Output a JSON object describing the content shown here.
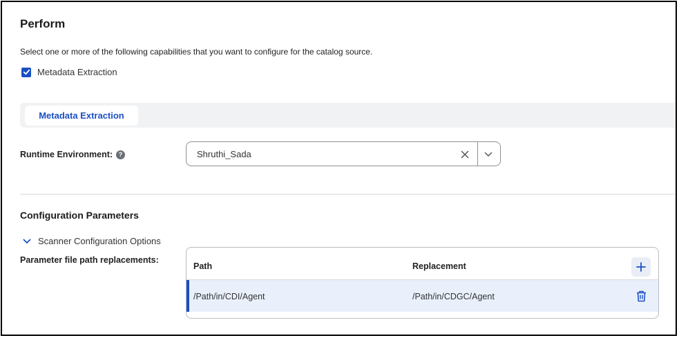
{
  "page": {
    "title": "Perform",
    "description": "Select one or more of the following capabilities that you want to configure for the catalog source."
  },
  "capabilities": [
    {
      "label": "Metadata Extraction",
      "checked": true
    }
  ],
  "tabs": [
    {
      "label": "Metadata Extraction",
      "active": true
    }
  ],
  "runtime": {
    "label": "Runtime Environment:",
    "help_glyph": "?",
    "value": "Shruthi_Sada"
  },
  "config": {
    "title": "Configuration Parameters",
    "section_label": "Scanner Configuration Options",
    "expanded": true,
    "path_replacements_label": "Parameter file path replacements:",
    "columns": [
      "Path",
      "Replacement"
    ],
    "rows": [
      {
        "path": "/Path/in/CDI/Agent",
        "replacement": "/Path/in/CDGC/Agent"
      }
    ]
  },
  "colors": {
    "accent": "#1a4fc4",
    "row_selected_bg": "#e9f0fb",
    "tab_bar_bg": "#f1f2f4"
  },
  "icons": {
    "checkbox": "check-icon",
    "help": "question-circle-icon",
    "clear": "close-icon",
    "dropdown": "chevron-down-icon",
    "expander": "chevron-down-icon",
    "add": "plus-icon",
    "delete": "trash-icon"
  }
}
